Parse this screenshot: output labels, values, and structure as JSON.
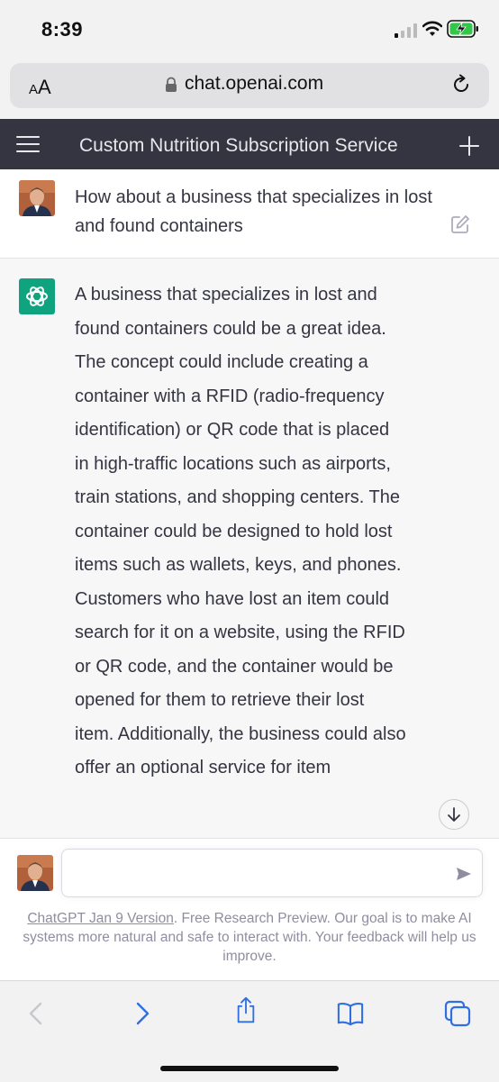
{
  "status_bar": {
    "time": "8:39"
  },
  "browser": {
    "aa_label_big": "A",
    "aa_label_small": "A",
    "url": "chat.openai.com"
  },
  "header": {
    "title": "Custom Nutrition Subscription Service"
  },
  "conversation": {
    "user_message": "How about a business that specializes in lost and found containers",
    "assistant_message": "A business that specializes in lost and found containers could be a great idea. The concept could include creating a container with a RFID (radio-frequency identification) or QR code that is placed in high-traffic locations such as airports, train stations, and shopping centers. The container could be designed to hold lost items such as wallets, keys, and phones. Customers who have lost an item could search for it on a website, using the RFID or QR code, and the container would be opened for them to retrieve their lost item. Additionally, the business could also offer an optional service for item"
  },
  "input": {
    "placeholder": "",
    "value": ""
  },
  "footer": {
    "version_link": "ChatGPT Jan 9 Version",
    "text": ". Free Research Preview. Our goal is to make AI systems more natural and safe to interact with. Your feedback will help us improve."
  },
  "colors": {
    "header_bg": "#343541",
    "brand": "#10a37f",
    "assistant_bg": "#f7f7f8"
  },
  "icons": [
    "menu-icon",
    "plus-icon",
    "edit-icon",
    "openai-logo-icon",
    "arrow-down-icon",
    "send-icon",
    "back-icon",
    "forward-icon",
    "share-icon",
    "bookmarks-icon",
    "tabs-icon",
    "lock-icon",
    "reload-icon"
  ]
}
